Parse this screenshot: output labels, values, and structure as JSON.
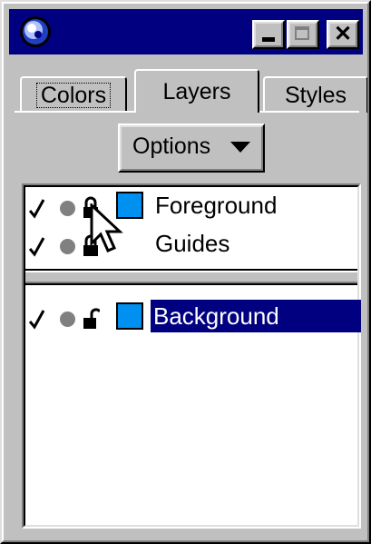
{
  "window": {
    "icon": "app-logo-icon",
    "controls": [
      "minimize-icon",
      "maximize-icon",
      "close-icon"
    ],
    "close_glyph": "✕"
  },
  "tabs": [
    {
      "label": "Colors",
      "active": false
    },
    {
      "label": "Layers",
      "active": true
    },
    {
      "label": "Styles",
      "active": false
    }
  ],
  "toolbar": {
    "options_label": "Options",
    "options_icon": "dropdown-arrow-icon"
  },
  "layers": {
    "top_section": [
      {
        "name": "Foreground",
        "visible": true,
        "locked": true,
        "has_color": true
      },
      {
        "name": "Guides",
        "visible": true,
        "locked": true,
        "has_color": false
      }
    ],
    "bottom_section": [
      {
        "name": "Background",
        "visible": true,
        "locked": false,
        "has_color": true,
        "selected": true
      }
    ]
  },
  "colors": {
    "titlebar": "#000080",
    "selection": "#000080",
    "layer_swatch": "#0090f0",
    "face": "#c0c0c0"
  }
}
